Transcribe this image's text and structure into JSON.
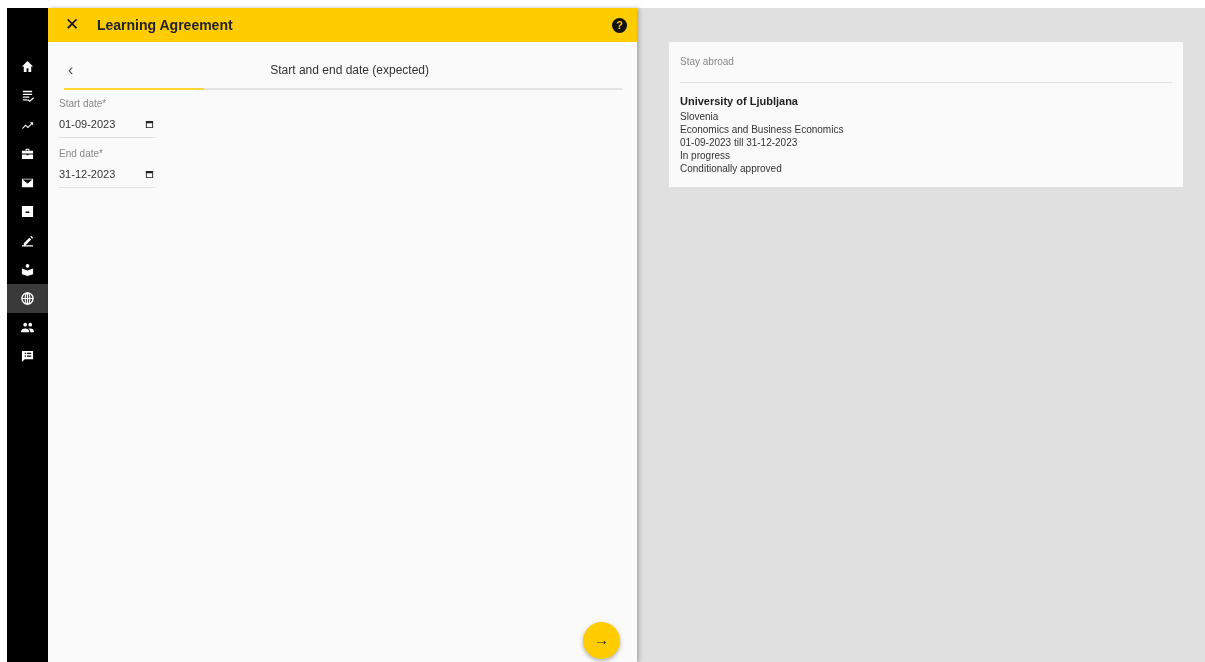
{
  "sidebar": {
    "items": [
      {
        "kind": "home",
        "selected": false
      },
      {
        "kind": "checklist",
        "selected": false
      },
      {
        "kind": "trend",
        "selected": false
      },
      {
        "kind": "briefcase",
        "selected": false
      },
      {
        "kind": "mail",
        "selected": false
      },
      {
        "kind": "archive",
        "selected": false
      },
      {
        "kind": "pen",
        "selected": false
      },
      {
        "kind": "reader",
        "selected": false
      },
      {
        "kind": "globe",
        "selected": true
      },
      {
        "kind": "people",
        "selected": false
      },
      {
        "kind": "chat",
        "selected": false
      }
    ]
  },
  "header": {
    "close": "✕",
    "title": "Learning Agreement",
    "help": "?"
  },
  "step": {
    "back": "‹",
    "title": "Start and end date (expected)",
    "level": 0.25
  },
  "fields": [
    {
      "label": "Start date*",
      "value": "01-09-2023"
    },
    {
      "label": "End date*",
      "value": "31-12-2023"
    }
  ],
  "next_button": "→",
  "summary": {
    "heading": "Stay abroad",
    "title": "University of Ljubljana",
    "lines": [
      "Slovenia",
      "Economics and Business Economics",
      "01-09-2023 till 31-12-2023",
      "In progress",
      "Conditionally approved"
    ]
  }
}
